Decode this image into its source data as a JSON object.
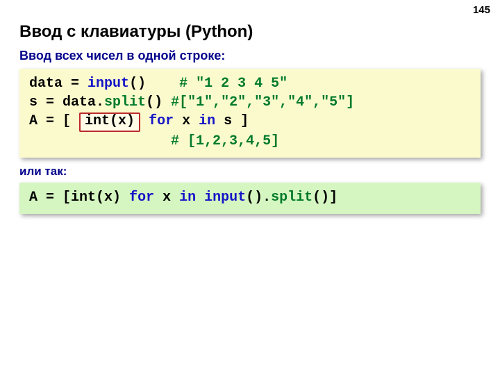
{
  "page_number": "145",
  "title": "Ввод с клавиатуры (Python)",
  "subtitle": "Ввод всех чисел в одной строке:",
  "note": "или так:",
  "code1": {
    "l1_a": "data ",
    "l1_b": "=",
    "l1_c": " ",
    "l1_d": "input",
    "l1_e": "()",
    "l1_pad": "    ",
    "l1_f": "# \"1 2 3 4 5\"",
    "l2_a": "s ",
    "l2_b": "=",
    "l2_c": " data.",
    "l2_d": "split",
    "l2_e": "() ",
    "l2_f": "#[\"1\",\"2\",\"3\",\"4\",\"5\"]",
    "l3_a": "A ",
    "l3_b": "=",
    "l3_c": " [ ",
    "l3_box": "int(x)",
    "l3_d": " ",
    "l3_e": "for",
    "l3_f": " x ",
    "l3_g": "in",
    "l3_h": " s ]",
    "l4_pad": "                 ",
    "l4_a": "# [1,2,3,4,5]"
  },
  "code2": {
    "a": "A ",
    "b": "=",
    "c": " [int(x) ",
    "d": "for",
    "e": " x ",
    "f": "in",
    "g": " ",
    "h": "input",
    "i": "().",
    "j": "split",
    "k": "()]"
  }
}
